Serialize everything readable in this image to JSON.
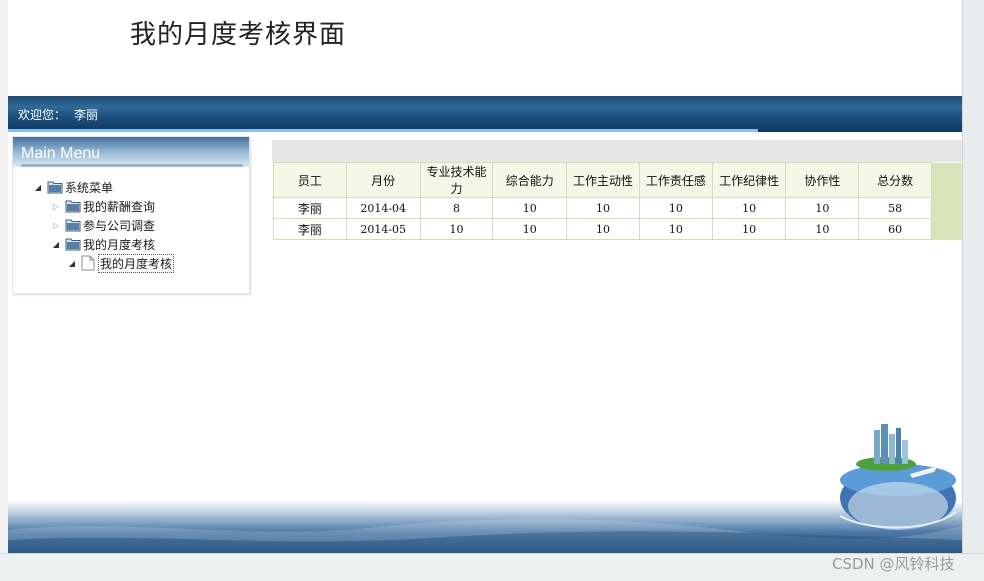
{
  "page": {
    "title": "我的月度考核界面"
  },
  "welcome": {
    "label": "欢迎您：",
    "user": "李丽"
  },
  "menu": {
    "title": "Main Menu",
    "tree": [
      {
        "label": "系统菜单",
        "expanded": true,
        "level": 0
      },
      {
        "label": "我的薪酬查询",
        "expanded": false,
        "level": 1
      },
      {
        "label": "参与公司调查",
        "expanded": false,
        "level": 1
      },
      {
        "label": "我的月度考核",
        "expanded": true,
        "level": 1
      },
      {
        "label": "我的月度考核",
        "level": 2,
        "selected": true
      }
    ]
  },
  "table": {
    "headers": [
      "员工",
      "月份",
      "专业技术能力",
      "综合能力",
      "工作主动性",
      "工作责任感",
      "工作纪律性",
      "协作性",
      "总分数"
    ],
    "rows": [
      [
        "李丽",
        "2014-04",
        "8",
        "10",
        "10",
        "10",
        "10",
        "10",
        "58"
      ],
      [
        "李丽",
        "2014-05",
        "10",
        "10",
        "10",
        "10",
        "10",
        "10",
        "60"
      ]
    ]
  },
  "watermark": "CSDN @风铃科技",
  "colors": {
    "welcome_bar": "#1b4f7c",
    "table_border": "#d6dcb8",
    "table_header_bg": "#f4f7e6",
    "table_side_pad": "#d9e3b8"
  }
}
